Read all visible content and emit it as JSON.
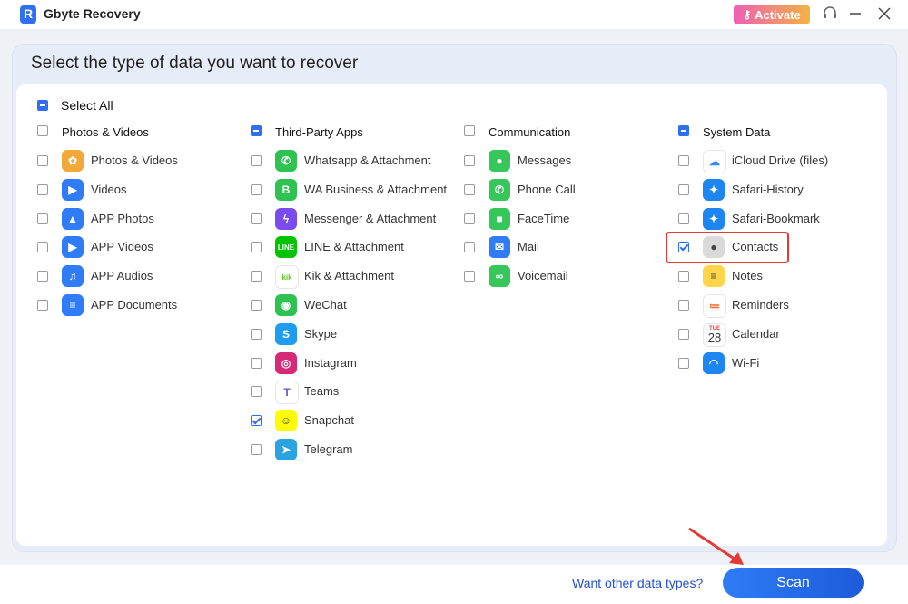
{
  "app": {
    "title": "Gbyte Recovery",
    "activate_label": "Activate"
  },
  "page": {
    "title": "Select the type of data you want to recover",
    "select_all_label": "Select All"
  },
  "categories": [
    {
      "label": "Photos & Videos",
      "state": "unchecked",
      "items": [
        {
          "label": "Photos & Videos",
          "icon": "photos-icon",
          "color": "#f3a93a",
          "checked": false
        },
        {
          "label": "Videos",
          "icon": "videos-icon",
          "color": "#2f7cf6",
          "checked": false
        },
        {
          "label": "APP Photos",
          "icon": "app-photos-icon",
          "color": "#2f7cf6",
          "checked": false
        },
        {
          "label": "APP Videos",
          "icon": "app-videos-icon",
          "color": "#2f7cf6",
          "checked": false
        },
        {
          "label": "APP Audios",
          "icon": "app-audios-icon",
          "color": "#2f7cf6",
          "checked": false
        },
        {
          "label": "APP Documents",
          "icon": "app-documents-icon",
          "color": "#2f7cf6",
          "checked": false
        }
      ]
    },
    {
      "label": "Third-Party Apps",
      "state": "partial",
      "items": [
        {
          "label": "Whatsapp & Attachment",
          "icon": "whatsapp-icon",
          "color": "#2fc250",
          "checked": false
        },
        {
          "label": "WA Business & Attachment",
          "icon": "wa-business-icon",
          "color": "#2fc250",
          "checked": false
        },
        {
          "label": "Messenger & Attachment",
          "icon": "messenger-icon",
          "color": "#7a4cf0",
          "checked": false
        },
        {
          "label": "LINE & Attachment",
          "icon": "line-icon",
          "color": "#00c300",
          "checked": false
        },
        {
          "label": "Kik & Attachment",
          "icon": "kik-icon",
          "color": "#ffffff",
          "checked": false
        },
        {
          "label": "WeChat",
          "icon": "wechat-icon",
          "color": "#2fc250",
          "checked": false
        },
        {
          "label": "Skype",
          "icon": "skype-icon",
          "color": "#1e9cf0",
          "checked": false
        },
        {
          "label": "Instagram",
          "icon": "instagram-icon",
          "color": "#d62976",
          "checked": false
        },
        {
          "label": "Teams",
          "icon": "teams-icon",
          "color": "#ffffff",
          "checked": false
        },
        {
          "label": "Snapchat",
          "icon": "snapchat-icon",
          "color": "#fffc00",
          "checked": true
        },
        {
          "label": "Telegram",
          "icon": "telegram-icon",
          "color": "#2aa3e0",
          "checked": false
        }
      ]
    },
    {
      "label": "Communication",
      "state": "unchecked",
      "items": [
        {
          "label": "Messages",
          "icon": "messages-icon",
          "color": "#35c759",
          "checked": false
        },
        {
          "label": "Phone Call",
          "icon": "phone-icon",
          "color": "#35c759",
          "checked": false
        },
        {
          "label": "FaceTime",
          "icon": "facetime-icon",
          "color": "#35c759",
          "checked": false
        },
        {
          "label": "Mail",
          "icon": "mail-icon",
          "color": "#2f7cf6",
          "checked": false
        },
        {
          "label": "Voicemail",
          "icon": "voicemail-icon",
          "color": "#35c759",
          "checked": false
        }
      ]
    },
    {
      "label": "System Data",
      "state": "partial",
      "items": [
        {
          "label": "iCloud Drive (files)",
          "icon": "icloud-icon",
          "color": "#ffffff",
          "checked": false
        },
        {
          "label": "Safari-History",
          "icon": "safari-icon",
          "color": "#1e86f0",
          "checked": false
        },
        {
          "label": "Safari-Bookmark",
          "icon": "safari-icon",
          "color": "#1e86f0",
          "checked": false
        },
        {
          "label": "Contacts",
          "icon": "contacts-icon",
          "color": "#d9d9d9",
          "checked": true
        },
        {
          "label": "Notes",
          "icon": "notes-icon",
          "color": "#ffd54a",
          "checked": false
        },
        {
          "label": "Reminders",
          "icon": "reminders-icon",
          "color": "#ffffff",
          "checked": false
        },
        {
          "label": "Calendar",
          "icon": "calendar-icon",
          "color": "#ffffff",
          "checked": false,
          "calendar_day": "TUE",
          "calendar_date": "28"
        },
        {
          "label": "Wi-Fi",
          "icon": "wifi-icon",
          "color": "#1e86f0",
          "checked": false
        }
      ]
    }
  ],
  "footer": {
    "other_link": "Want other data types?",
    "scan_label": "Scan"
  },
  "colors": {
    "accent": "#2f6ff0",
    "highlight": "#e53935"
  }
}
